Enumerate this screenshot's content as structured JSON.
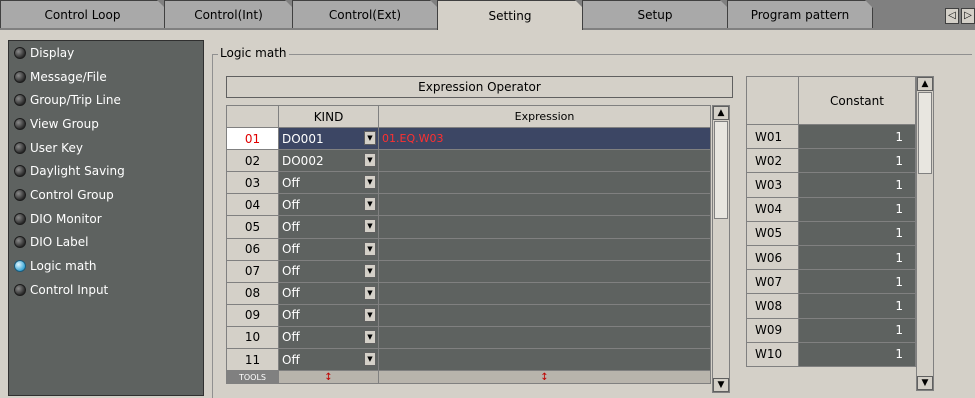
{
  "tabs": [
    {
      "label": "Control Loop",
      "active": false
    },
    {
      "label": "Control(Int)",
      "active": false
    },
    {
      "label": "Control(Ext)",
      "active": false
    },
    {
      "label": "Setting",
      "active": true
    },
    {
      "label": "Setup",
      "active": false
    },
    {
      "label": "Program pattern",
      "active": false
    }
  ],
  "tab_arrows": {
    "left": "◁",
    "right": "▷"
  },
  "sidebar": {
    "items": [
      {
        "label": "Display",
        "selected": false
      },
      {
        "label": "Message/File",
        "selected": false
      },
      {
        "label": "Group/Trip Line",
        "selected": false
      },
      {
        "label": "View Group",
        "selected": false
      },
      {
        "label": "User Key",
        "selected": false
      },
      {
        "label": "Daylight Saving",
        "selected": false
      },
      {
        "label": "Control Group",
        "selected": false
      },
      {
        "label": "DIO Monitor",
        "selected": false
      },
      {
        "label": "DIO Label",
        "selected": false
      },
      {
        "label": "Logic math",
        "selected": true
      },
      {
        "label": "Control Input",
        "selected": false
      }
    ]
  },
  "group_title": "Logic math",
  "expression_operator_label": "Expression Operator",
  "logic_table": {
    "headers": {
      "no": "",
      "kind": "KIND",
      "expression": "Expression"
    },
    "rows": [
      {
        "no": "01",
        "kind": "DO001",
        "expression": "01.EQ.W03",
        "selected": true
      },
      {
        "no": "02",
        "kind": "DO002",
        "expression": ""
      },
      {
        "no": "03",
        "kind": "Off",
        "expression": ""
      },
      {
        "no": "04",
        "kind": "Off",
        "expression": ""
      },
      {
        "no": "05",
        "kind": "Off",
        "expression": ""
      },
      {
        "no": "06",
        "kind": "Off",
        "expression": ""
      },
      {
        "no": "07",
        "kind": "Off",
        "expression": ""
      },
      {
        "no": "08",
        "kind": "Off",
        "expression": ""
      },
      {
        "no": "09",
        "kind": "Off",
        "expression": ""
      },
      {
        "no": "10",
        "kind": "Off",
        "expression": ""
      },
      {
        "no": "11",
        "kind": "Off",
        "expression": ""
      }
    ],
    "tools_label": "TOOLS",
    "tools_marker": "↕"
  },
  "constant_table": {
    "header": "Constant",
    "rows": [
      {
        "name": "W01",
        "value": "1"
      },
      {
        "name": "W02",
        "value": "1"
      },
      {
        "name": "W03",
        "value": "1"
      },
      {
        "name": "W04",
        "value": "1"
      },
      {
        "name": "W05",
        "value": "1"
      },
      {
        "name": "W06",
        "value": "1"
      },
      {
        "name": "W07",
        "value": "1"
      },
      {
        "name": "W08",
        "value": "1"
      },
      {
        "name": "W09",
        "value": "1"
      },
      {
        "name": "W10",
        "value": "1"
      }
    ]
  },
  "icons": {
    "up": "▲",
    "down": "▼",
    "dropdown": "▼"
  },
  "colors": {
    "panel_dark": "#5e6260",
    "selected_row": "#3c4664",
    "error_text": "#ff3030",
    "selected_led": "#3aa6d6"
  }
}
